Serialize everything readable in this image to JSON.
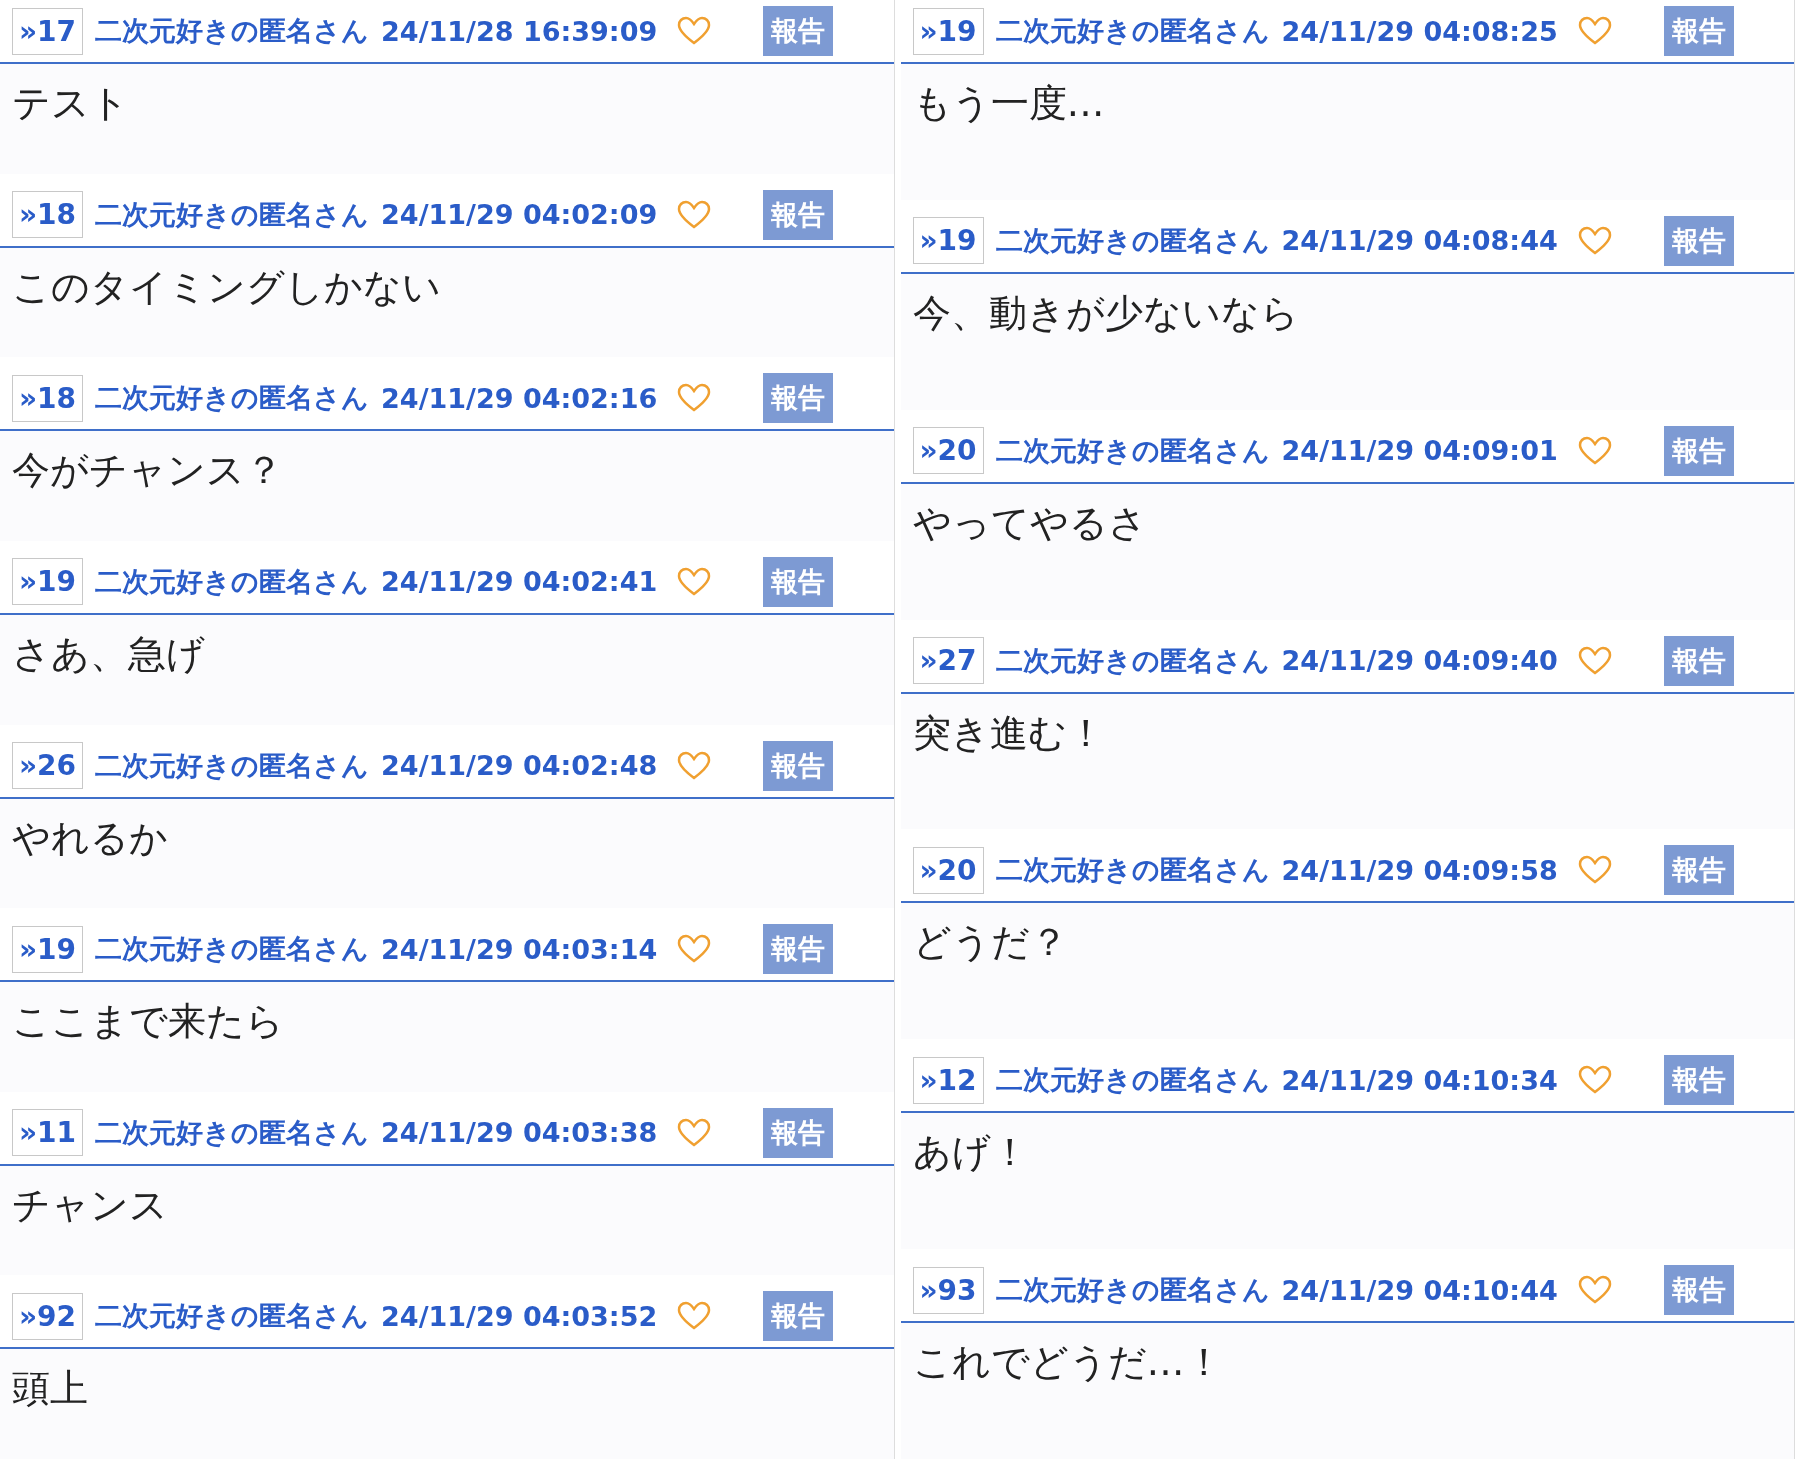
{
  "columns": [
    {
      "posts": [
        {
          "ref": "»17",
          "author": "二次元好きの匿名さん",
          "time": "24/11/28 16:39:09",
          "report": "報告",
          "message": "テスト"
        },
        {
          "ref": "»18",
          "author": "二次元好きの匿名さん",
          "time": "24/11/29 04:02:09",
          "report": "報告",
          "message": "このタイミングしかない"
        },
        {
          "ref": "»18",
          "author": "二次元好きの匿名さん",
          "time": "24/11/29 04:02:16",
          "report": "報告",
          "message": "今がチャンス？"
        },
        {
          "ref": "»19",
          "author": "二次元好きの匿名さん",
          "time": "24/11/29 04:02:41",
          "report": "報告",
          "message": "さあ、急げ"
        },
        {
          "ref": "»26",
          "author": "二次元好きの匿名さん",
          "time": "24/11/29 04:02:48",
          "report": "報告",
          "message": "やれるか"
        },
        {
          "ref": "»19",
          "author": "二次元好きの匿名さん",
          "time": "24/11/29 04:03:14",
          "report": "報告",
          "message": "ここまで来たら"
        },
        {
          "ref": "»11",
          "author": "二次元好きの匿名さん",
          "time": "24/11/29 04:03:38",
          "report": "報告",
          "message": "チャンス"
        },
        {
          "ref": "»92",
          "author": "二次元好きの匿名さん",
          "time": "24/11/29 04:03:52",
          "report": "報告",
          "message": "頭上"
        }
      ]
    },
    {
      "posts": [
        {
          "ref": "»19",
          "author": "二次元好きの匿名さん",
          "time": "24/11/29 04:08:25",
          "report": "報告",
          "message": "もう一度…"
        },
        {
          "ref": "»19",
          "author": "二次元好きの匿名さん",
          "time": "24/11/29 04:08:44",
          "report": "報告",
          "message": "今、動きが少ないなら"
        },
        {
          "ref": "»20",
          "author": "二次元好きの匿名さん",
          "time": "24/11/29 04:09:01",
          "report": "報告",
          "message": "やってやるさ"
        },
        {
          "ref": "»27",
          "author": "二次元好きの匿名さん",
          "time": "24/11/29 04:09:40",
          "report": "報告",
          "message": "突き進む！"
        },
        {
          "ref": "»20",
          "author": "二次元好きの匿名さん",
          "time": "24/11/29 04:09:58",
          "report": "報告",
          "message": "どうだ？"
        },
        {
          "ref": "»12",
          "author": "二次元好きの匿名さん",
          "time": "24/11/29 04:10:34",
          "report": "報告",
          "message": "あげ！"
        },
        {
          "ref": "»93",
          "author": "二次元好きの匿名さん",
          "time": "24/11/29 04:10:44",
          "report": "報告",
          "message": "これでどうだ…！"
        }
      ]
    }
  ]
}
